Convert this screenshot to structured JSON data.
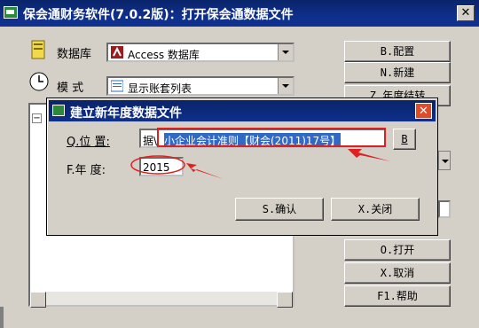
{
  "window": {
    "title": "保会通财务软件(7.0.2版)：打开保会通数据文件",
    "close_glyph": "✕"
  },
  "main": {
    "db_label": "数据库",
    "db_value": "Access 数据库",
    "mode_label": "模  式",
    "mode_value": "显示账套列表",
    "tree_collapse_glyph": "−"
  },
  "buttons": {
    "config": "B.配置",
    "new": "N.新建",
    "year_end": "Z.年度结转",
    "open": "O.打开",
    "cancel": "X.取消",
    "help": "F1.帮助"
  },
  "dialog": {
    "title": "建立新年度数据文件",
    "close_glyph": "✕",
    "location_label": "Q.位  置:",
    "location_prefix": "据\\",
    "location_selected": "小企业会计准则【财会(2011)17号】",
    "browse_label": "B",
    "year_label": "F.年  度:",
    "year_value": "2015",
    "confirm": "S.确认",
    "close": "X.关闭"
  },
  "colors": {
    "title_bar": "#0a246a",
    "face": "#d4d0c8",
    "selection": "#316ac5",
    "annotation": "#e02020"
  }
}
